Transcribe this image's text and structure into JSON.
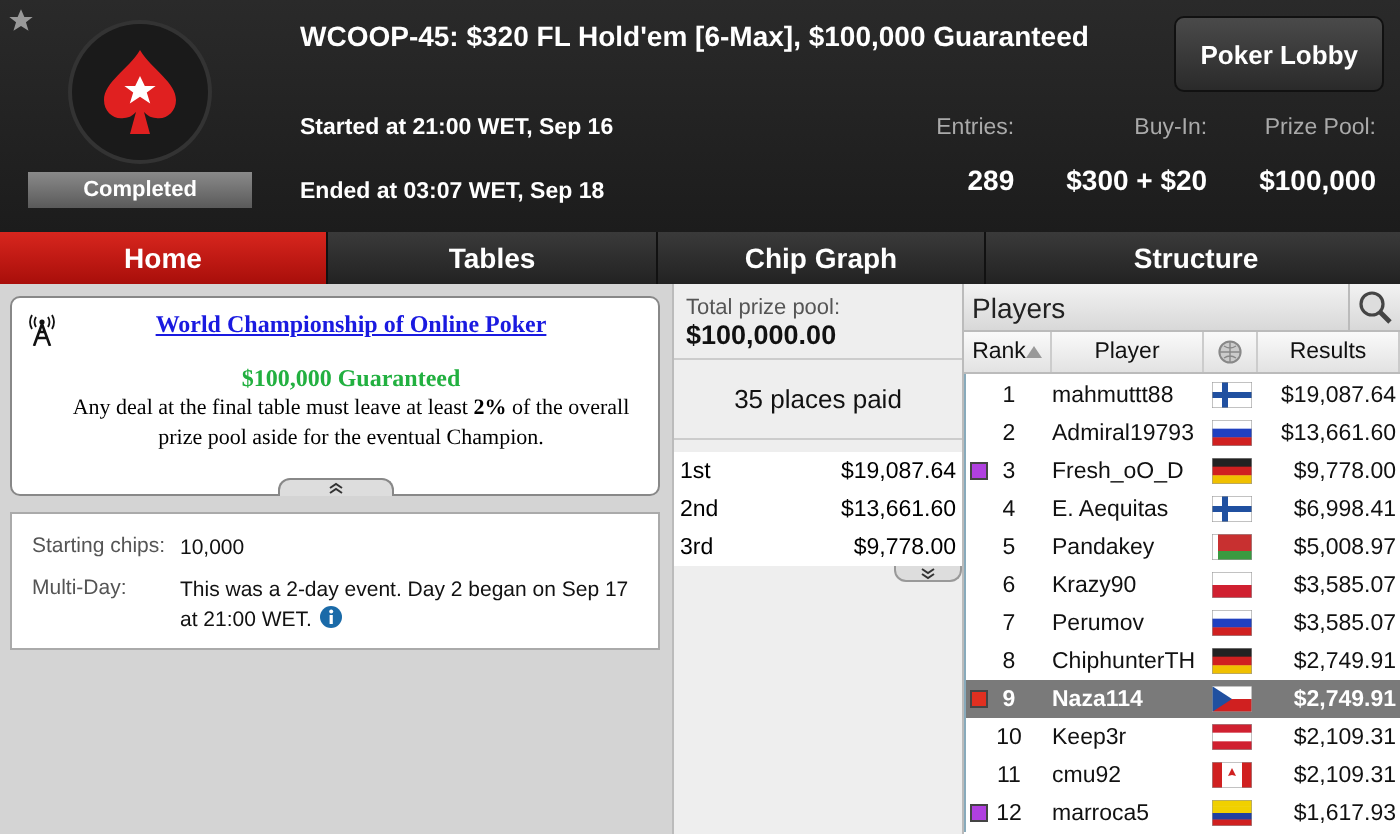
{
  "header": {
    "title": "WCOOP-45: $320 FL Hold'em [6-Max], $100,000 Guaranteed",
    "lobby_button": "Poker Lobby",
    "status": "Completed",
    "started": "Started at 21:00 WET, Sep 16",
    "ended": "Ended at 03:07 WET, Sep 18",
    "stats": [
      {
        "label": "Entries:",
        "value": "289"
      },
      {
        "label": "Buy-In:",
        "value": "$300 + $20"
      },
      {
        "label": "Prize Pool:",
        "value": "$100,000"
      }
    ]
  },
  "tabs": [
    {
      "label": "Home",
      "selected": true
    },
    {
      "label": "Tables",
      "selected": false
    },
    {
      "label": "Chip Graph",
      "selected": false
    },
    {
      "label": "Structure",
      "selected": false
    }
  ],
  "info": {
    "link": "World Championship of Online Poker",
    "guarantee": "$100,000 Guaranteed",
    "text": "Any deal at the final table must leave at least **2%** of the overall prize pool aside for the eventual Champion."
  },
  "details": [
    {
      "label": "Starting chips:",
      "value": "10,000",
      "info_icon": false
    },
    {
      "label": "Multi-Day:",
      "value": "This was a 2-day event. Day 2 began on Sep 17 at 21:00 WET.",
      "info_icon": true
    }
  ],
  "prizes": {
    "total_label": "Total prize pool:",
    "total": "$100,000.00",
    "places": "35 places paid",
    "rows": [
      {
        "place": "1st",
        "amount": "$19,087.64"
      },
      {
        "place": "2nd",
        "amount": "$13,661.60"
      },
      {
        "place": "3rd",
        "amount": "$9,778.00"
      }
    ]
  },
  "players": {
    "title": "Players",
    "columns": [
      "Rank",
      "Player",
      "Results"
    ],
    "rows": [
      {
        "rank": "1",
        "name": "mahmuttt88",
        "flag": {
          "kind": "fi"
        },
        "result": "$19,087.64",
        "selected": false
      },
      {
        "rank": "2",
        "name": "Admiral19793",
        "flag": {
          "kind": "ru"
        },
        "result": "$13,661.60",
        "selected": false
      },
      {
        "rank": "3",
        "name": "Fresh_oO_D",
        "flag": {
          "kind": "de"
        },
        "result": "$9,778.00",
        "selected": false,
        "color": "#b040e0"
      },
      {
        "rank": "4",
        "name": "E. Aequitas",
        "flag": {
          "kind": "fi"
        },
        "result": "$6,998.41",
        "selected": false
      },
      {
        "rank": "5",
        "name": "Pandakey",
        "flag": {
          "kind": "by"
        },
        "result": "$5,008.97",
        "selected": false
      },
      {
        "rank": "6",
        "name": "Krazy90",
        "flag": {
          "kind": "pl"
        },
        "result": "$3,585.07",
        "selected": false
      },
      {
        "rank": "7",
        "name": "Perumov",
        "flag": {
          "kind": "ru"
        },
        "result": "$3,585.07",
        "selected": false
      },
      {
        "rank": "8",
        "name": "ChiphunterTH",
        "flag": {
          "kind": "de"
        },
        "result": "$2,749.91",
        "selected": false
      },
      {
        "rank": "9",
        "name": "Naza114",
        "flag": {
          "kind": "cz"
        },
        "result": "$2,749.91",
        "selected": true,
        "color": "#e03020"
      },
      {
        "rank": "10",
        "name": "Keep3r",
        "flag": {
          "kind": "at"
        },
        "result": "$2,109.31",
        "selected": false
      },
      {
        "rank": "11",
        "name": "cmu92",
        "flag": {
          "kind": "ca"
        },
        "result": "$2,109.31",
        "selected": false
      },
      {
        "rank": "12",
        "name": "marroca5",
        "flag": {
          "kind": "co"
        },
        "result": "$1,617.93",
        "selected": false,
        "color": "#b040e0"
      }
    ]
  }
}
